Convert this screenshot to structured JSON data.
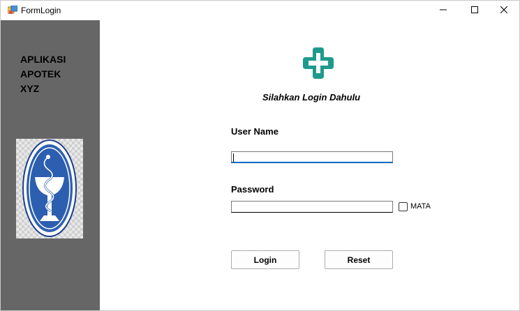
{
  "window": {
    "title": "FormLogin"
  },
  "sidebar": {
    "brand_lines": [
      "APLIKASI",
      "APOTEK",
      "XYZ"
    ]
  },
  "main": {
    "heading": "Silahkan Login Dahulu",
    "username": {
      "label": "User Name",
      "value": ""
    },
    "password": {
      "label": "Password",
      "value": ""
    },
    "show_password": {
      "label": "MATA",
      "checked": false
    },
    "buttons": {
      "login": "Login",
      "reset": "Reset"
    }
  },
  "colors": {
    "sidebar_bg": "#666666",
    "accent": "#0067c0",
    "logo_teal": "#1e9a8c",
    "logo_blue": "#2d5fb0"
  },
  "icons": [
    "app-form-icon",
    "minimize-icon",
    "maximize-icon",
    "close-icon",
    "medical-cross-icon",
    "pharmacy-logo"
  ]
}
